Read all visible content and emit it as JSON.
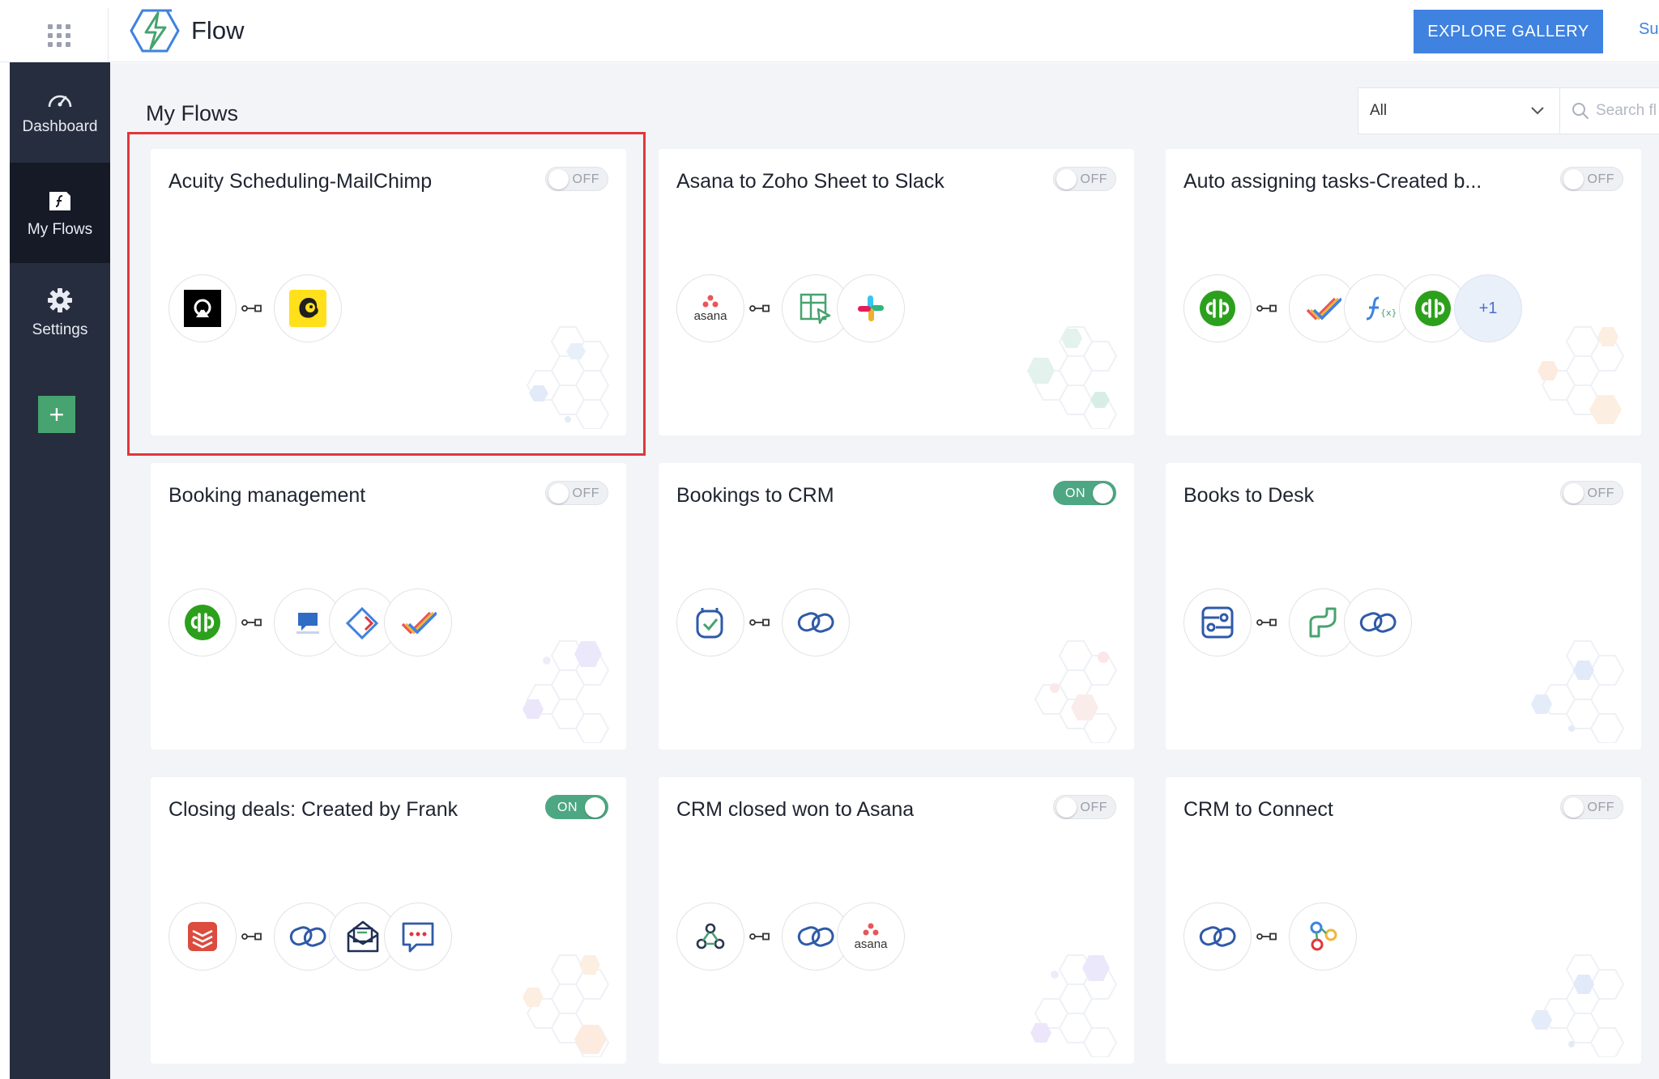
{
  "app": {
    "title": "Flow"
  },
  "header": {
    "explore_label": "EXPLORE GALLERY",
    "su_label": "Su"
  },
  "sidebar": {
    "items": [
      {
        "label": "Dashboard",
        "icon": "gauge-icon"
      },
      {
        "label": "My Flows",
        "icon": "flow-file-icon"
      },
      {
        "label": "Settings",
        "icon": "gear-icon"
      }
    ],
    "add_label": "+"
  },
  "main": {
    "title": "My Flows",
    "filter": {
      "value": "All"
    },
    "search": {
      "placeholder": "Search fl"
    }
  },
  "cards": [
    {
      "title": "Acuity Scheduling-MailChimp",
      "toggle": "OFF",
      "icons": [
        "acuity-scheduling-icon",
        "mailchimp-icon"
      ]
    },
    {
      "title": "Asana to Zoho Sheet to Slack",
      "toggle": "OFF",
      "icons": [
        "asana-icon",
        "zoho-sheet-icon",
        "slack-icon"
      ],
      "asana_text": "asana"
    },
    {
      "title": "Auto assigning tasks-Created b...",
      "toggle": "OFF",
      "icons": [
        "quickbooks-icon",
        "checkmark-icon",
        "function-icon",
        "quickbooks-icon"
      ],
      "more": "+1"
    },
    {
      "title": "Booking management",
      "toggle": "OFF",
      "icons": [
        "quickbooks-icon",
        "clicksend-icon",
        "diamond-tag-icon",
        "checkmark-icon"
      ]
    },
    {
      "title": "Bookings to CRM",
      "toggle": "ON",
      "icons": [
        "zoho-bookings-icon",
        "zoho-crm-icon"
      ]
    },
    {
      "title": "Books to Desk",
      "toggle": "OFF",
      "icons": [
        "zoho-books-icon",
        "zoho-desk-icon",
        "zoho-crm-icon"
      ]
    },
    {
      "title": "Closing deals: Created by Frank",
      "toggle": "ON",
      "icons": [
        "todoist-icon",
        "zoho-crm-icon",
        "envelope-icon",
        "chat-bubble-icon"
      ]
    },
    {
      "title": "CRM closed won to Asana",
      "toggle": "OFF",
      "icons": [
        "webhook-icon",
        "zoho-crm-icon",
        "asana-icon"
      ],
      "asana_text": "asana"
    },
    {
      "title": "CRM to Connect",
      "toggle": "OFF",
      "icons": [
        "zoho-crm-icon",
        "zoho-connect-icon"
      ]
    }
  ],
  "colors": {
    "accent": "#3f82e0",
    "sidebar": "#262d3e",
    "sidebar_active": "#151a26",
    "toggle_on": "#4ea783",
    "highlight": "#e0373c"
  }
}
